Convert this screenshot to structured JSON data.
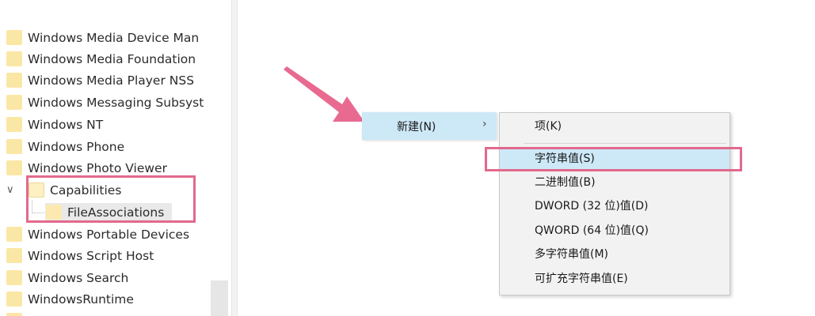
{
  "tree": {
    "items": [
      {
        "label": "Windows Media Device Man"
      },
      {
        "label": "Windows Media Foundation"
      },
      {
        "label": "Windows Media Player NSS"
      },
      {
        "label": "Windows Messaging Subsyst"
      },
      {
        "label": "Windows NT"
      },
      {
        "label": "Windows Phone"
      },
      {
        "label": "Windows Photo Viewer"
      },
      {
        "label": "Capabilities"
      },
      {
        "label": "FileAssociations"
      },
      {
        "label": "Windows Portable Devices"
      },
      {
        "label": "Windows Script Host"
      },
      {
        "label": "Windows Search"
      },
      {
        "label": "WindowsRuntime"
      }
    ],
    "expanded_glyph": "∨"
  },
  "context_menu": {
    "new_label": "新建(N)",
    "chevron": "›"
  },
  "submenu": {
    "items": [
      {
        "label": "项(K)"
      },
      {
        "label": "字符串值(S)"
      },
      {
        "label": "二进制值(B)"
      },
      {
        "label": "DWORD (32 位)值(D)"
      },
      {
        "label": "QWORD (64 位)值(Q)"
      },
      {
        "label": "多字符串值(M)"
      },
      {
        "label": "可扩充字符串值(E)"
      }
    ]
  },
  "colors": {
    "annotation": "#e2698d",
    "menu_highlight": "#cde8f7",
    "folder": "#fbe7a5"
  }
}
